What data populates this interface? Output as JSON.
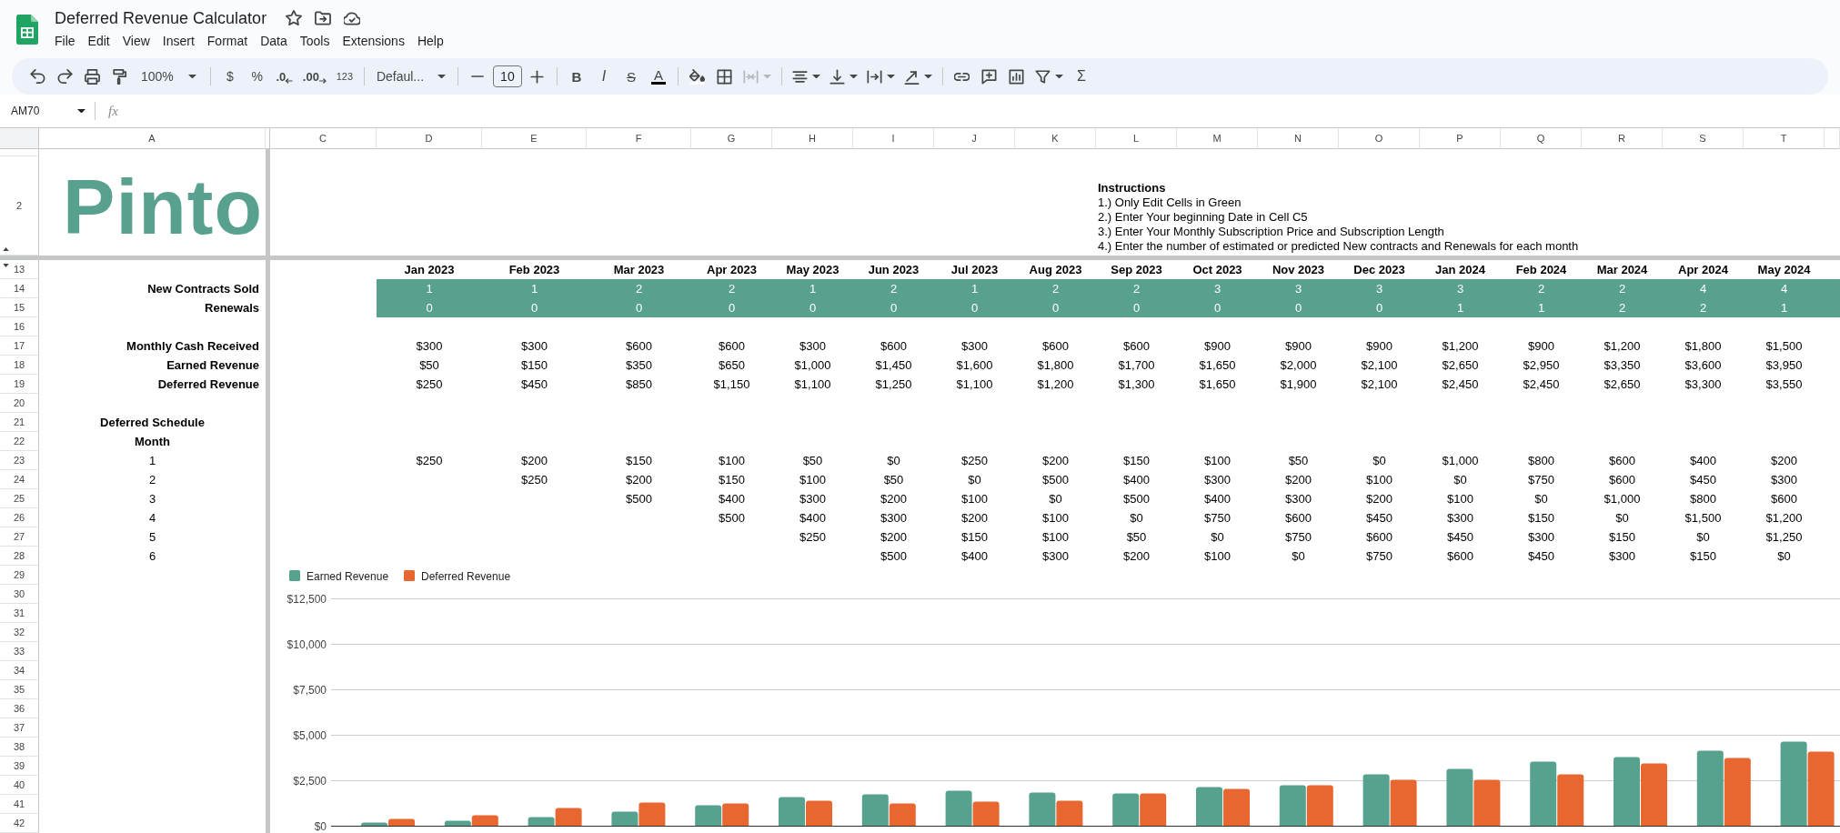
{
  "window": {
    "title": "Deferred Revenue Calculator"
  },
  "menu": [
    "File",
    "Edit",
    "View",
    "Insert",
    "Format",
    "Data",
    "Tools",
    "Extensions",
    "Help"
  ],
  "toolbar": {
    "zoom": "100%",
    "currency": "$",
    "percent": "%",
    "decrease_decimal": ".0",
    "increase_decimal": ".00",
    "number_format": "123",
    "font": "Defaul...",
    "font_size": "10",
    "bold": "B",
    "italic": "I",
    "strikethrough": "S",
    "text_color": "A",
    "merge_cells": {
      "disabled": true
    },
    "functions": "Σ"
  },
  "formula_bar": {
    "cell_ref": "AM70",
    "fx": "fx"
  },
  "sheet": {
    "columns": [
      "A",
      "C",
      "D",
      "E",
      "F",
      "G",
      "H",
      "I",
      "J",
      "K",
      "L",
      "M",
      "N",
      "O",
      "P",
      "Q",
      "R",
      "S",
      "T"
    ],
    "logo_row": {
      "number": "2",
      "logo": "Pinto"
    },
    "instructions": {
      "title": "Instructions",
      "lines": [
        "1.) Only Edit Cells in Green",
        "2.) Enter Your beginning Date in Cell C5",
        "3.) Enter Your Monthly Subscription Price and Subscription Length",
        "4.) Enter the number of estimated or predicted New contracts and Renewals for each month"
      ]
    },
    "rows": [
      {
        "number": "13",
        "kind": "header",
        "cells": [
          "Jan 2023",
          "Feb 2023",
          "Mar 2023",
          "Apr 2023",
          "May 2023",
          "Jun 2023",
          "Jul 2023",
          "Aug 2023",
          "Sep 2023",
          "Oct 2023",
          "Nov 2023",
          "Dec 2023",
          "Jan 2024",
          "Feb 2024",
          "Mar 2024",
          "Apr 2024",
          "May 2024"
        ]
      },
      {
        "number": "14",
        "kind": "input",
        "label": "New Contracts Sold",
        "cells": [
          "1",
          "1",
          "2",
          "2",
          "1",
          "2",
          "1",
          "2",
          "2",
          "3",
          "3",
          "3",
          "3",
          "2",
          "2",
          "4",
          "4"
        ]
      },
      {
        "number": "15",
        "kind": "input",
        "label": "Renewals",
        "cells": [
          "0",
          "0",
          "0",
          "0",
          "0",
          "0",
          "0",
          "0",
          "0",
          "0",
          "0",
          "0",
          "1",
          "1",
          "2",
          "2",
          "1"
        ]
      },
      {
        "number": "16",
        "kind": "blank"
      },
      {
        "number": "17",
        "kind": "value",
        "label": "Monthly Cash Received",
        "cells": [
          "$300",
          "$300",
          "$600",
          "$600",
          "$300",
          "$600",
          "$300",
          "$600",
          "$600",
          "$900",
          "$900",
          "$900",
          "$1,200",
          "$900",
          "$1,200",
          "$1,800",
          "$1,500"
        ]
      },
      {
        "number": "18",
        "kind": "value",
        "label": "Earned Revenue",
        "cells": [
          "$50",
          "$150",
          "$350",
          "$650",
          "$1,000",
          "$1,450",
          "$1,600",
          "$1,800",
          "$1,700",
          "$1,650",
          "$2,000",
          "$2,100",
          "$2,650",
          "$2,950",
          "$3,350",
          "$3,600",
          "$3,950"
        ]
      },
      {
        "number": "19",
        "kind": "value",
        "label": "Deferred Revenue",
        "cells": [
          "$250",
          "$450",
          "$850",
          "$1,150",
          "$1,100",
          "$1,250",
          "$1,100",
          "$1,200",
          "$1,300",
          "$1,650",
          "$1,900",
          "$2,100",
          "$2,450",
          "$2,450",
          "$2,650",
          "$3,300",
          "$3,550"
        ]
      },
      {
        "number": "20",
        "kind": "blank"
      },
      {
        "number": "21",
        "kind": "section",
        "label": "Deferred Schedule"
      },
      {
        "number": "22",
        "kind": "section",
        "label": "Month"
      },
      {
        "number": "23",
        "kind": "schedule",
        "label": "1",
        "cells": [
          "$250",
          "$200",
          "$150",
          "$100",
          "$50",
          "$0",
          "$250",
          "$200",
          "$150",
          "$100",
          "$50",
          "$0",
          "$1,000",
          "$800",
          "$600",
          "$400",
          "$200"
        ]
      },
      {
        "number": "24",
        "kind": "schedule",
        "label": "2",
        "cells": [
          null,
          "$250",
          "$200",
          "$150",
          "$100",
          "$50",
          "$0",
          "$500",
          "$400",
          "$300",
          "$200",
          "$100",
          "$0",
          "$750",
          "$600",
          "$450",
          "$300"
        ]
      },
      {
        "number": "25",
        "kind": "schedule",
        "label": "3",
        "cells": [
          null,
          null,
          "$500",
          "$400",
          "$300",
          "$200",
          "$100",
          "$0",
          "$500",
          "$400",
          "$300",
          "$200",
          "$100",
          "$0",
          "$1,000",
          "$800",
          "$600"
        ]
      },
      {
        "number": "26",
        "kind": "schedule",
        "label": "4",
        "cells": [
          null,
          null,
          null,
          "$500",
          "$400",
          "$300",
          "$200",
          "$100",
          "$0",
          "$750",
          "$600",
          "$450",
          "$300",
          "$150",
          "$0",
          "$1,500",
          "$1,200"
        ]
      },
      {
        "number": "27",
        "kind": "schedule",
        "label": "5",
        "cells": [
          null,
          null,
          null,
          null,
          "$250",
          "$200",
          "$150",
          "$100",
          "$50",
          "$0",
          "$750",
          "$600",
          "$450",
          "$300",
          "$150",
          "$0",
          "$1,250"
        ]
      },
      {
        "number": "28",
        "kind": "schedule",
        "label": "6",
        "cells": [
          null,
          null,
          null,
          null,
          null,
          "$500",
          "$400",
          "$300",
          "$200",
          "$100",
          "$0",
          "$750",
          "$600",
          "$450",
          "$300",
          "$150",
          "$0"
        ]
      }
    ],
    "chart_rows": [
      "29",
      "30",
      "31",
      "32",
      "33",
      "34",
      "35",
      "36",
      "37",
      "38",
      "39",
      "40",
      "41",
      "42"
    ],
    "chart": {
      "chart_data": {
        "type": "bar",
        "grid": true,
        "legend": true,
        "ylim": [
          0,
          12500
        ],
        "yticks": [
          {
            "value": 0,
            "label": "$0"
          },
          {
            "value": 2500,
            "label": "$2,500"
          },
          {
            "value": 5000,
            "label": "$5,000"
          },
          {
            "value": 7500,
            "label": "$7,500"
          },
          {
            "value": 10000,
            "label": "$10,000"
          },
          {
            "value": 12500,
            "label": "$12,500"
          }
        ],
        "series": [
          {
            "name": "Earned Revenue",
            "color": "#57a18f",
            "values": [
              200,
              300,
              500,
              800,
              1150,
              1600,
              1750,
              1950,
              1850,
              1800,
              2150,
              2250,
              2850,
              3150,
              3550,
              3800,
              4150,
              4650
            ]
          },
          {
            "name": "Deferred Revenue",
            "color": "#e86731",
            "values": [
              400,
              600,
              1000,
              1300,
              1250,
              1400,
              1250,
              1350,
              1400,
              1800,
              2050,
              2250,
              2550,
              2550,
              2850,
              3450,
              3750,
              4100
            ]
          }
        ]
      }
    }
  }
}
